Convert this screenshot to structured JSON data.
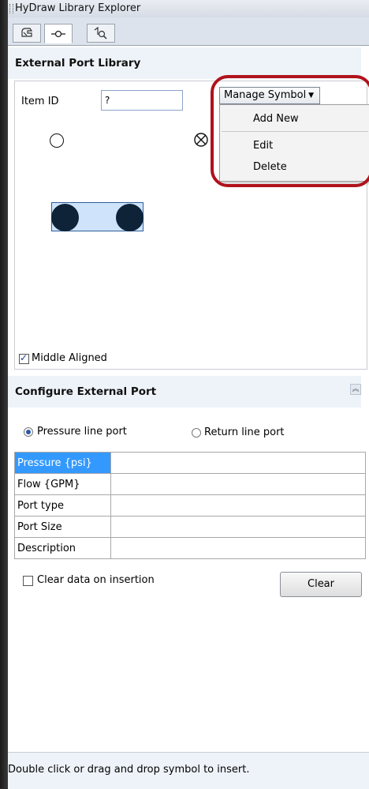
{
  "window": {
    "title": "HyDraw Library Explorer"
  },
  "tabs": [
    {
      "icon": "palette-icon"
    },
    {
      "icon": "port-connector-icon",
      "active": true
    },
    {
      "icon": "component-search-icon"
    }
  ],
  "library": {
    "header": "External Port Library",
    "item_id_label": "Item ID",
    "item_id_value": "?",
    "manage_symbol_label": "Manage Symbol",
    "manage_menu": [
      "Add New",
      "Edit",
      "Delete"
    ],
    "middle_aligned_label": "Middle Aligned",
    "middle_aligned_checked": true
  },
  "configure": {
    "header": "Configure External Port",
    "radio_pressure": "Pressure line port",
    "radio_return": "Return line port",
    "selected_radio": "pressure",
    "properties": [
      {
        "key": "Pressure {psi}",
        "value": ""
      },
      {
        "key": "Flow {GPM}",
        "value": ""
      },
      {
        "key": "Port type",
        "value": ""
      },
      {
        "key": "Port Size",
        "value": ""
      },
      {
        "key": "Description",
        "value": ""
      }
    ],
    "clear_on_insert_label": "Clear data on insertion",
    "clear_button": "Clear"
  },
  "status": {
    "text": "Double click or drag and drop symbol to insert."
  },
  "colors": {
    "highlight": "#b0121c",
    "selection": "#3399ff",
    "symbol_fill": "#0e2338"
  }
}
